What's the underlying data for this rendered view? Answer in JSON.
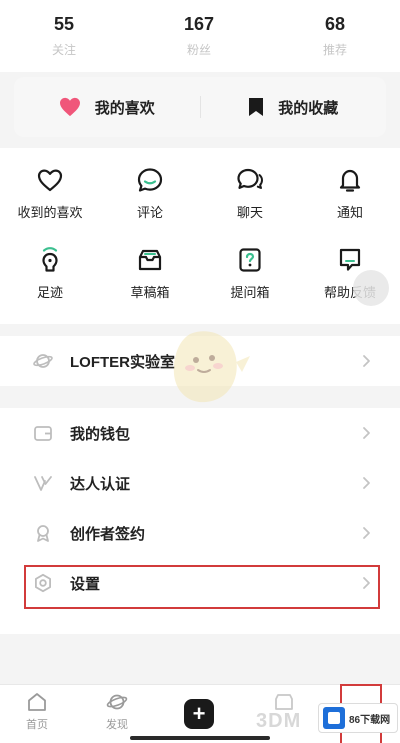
{
  "stats": [
    {
      "number": "55",
      "label": "关注"
    },
    {
      "number": "167",
      "label": "粉丝"
    },
    {
      "number": "68",
      "label": "推荐"
    }
  ],
  "favorites": {
    "likes_label": "我的喜欢",
    "collections_label": "我的收藏",
    "likes_icon": "heart-icon",
    "collections_icon": "bookmark-icon",
    "accent_color": "#f0567a"
  },
  "grid": [
    {
      "label": "收到的喜欢",
      "icon": "heart-outline-icon"
    },
    {
      "label": "评论",
      "icon": "comment-icon"
    },
    {
      "label": "聊天",
      "icon": "chat-icon"
    },
    {
      "label": "通知",
      "icon": "bell-icon"
    },
    {
      "label": "足迹",
      "icon": "footprint-icon"
    },
    {
      "label": "草稿箱",
      "icon": "drafts-icon"
    },
    {
      "label": "提问箱",
      "icon": "question-box-icon"
    },
    {
      "label": "帮助反馈",
      "icon": "help-feedback-icon"
    }
  ],
  "menu": {
    "lab": {
      "label": "LOFTER实验室",
      "icon": "planet-icon"
    },
    "wallet": {
      "label": "我的钱包",
      "icon": "wallet-icon"
    },
    "verify": {
      "label": "达人认证",
      "icon": "verify-icon"
    },
    "creator": {
      "label": "创作者签约",
      "icon": "creator-icon"
    },
    "settings": {
      "label": "设置",
      "icon": "gear-icon"
    }
  },
  "tabbar": {
    "home_label": "首页",
    "discover_label": "发现",
    "post_icon": "plus-icon",
    "highlight_color": "#d23b3b"
  },
  "watermarks": {
    "game_site": "3DM",
    "download_site": "86下载网"
  }
}
